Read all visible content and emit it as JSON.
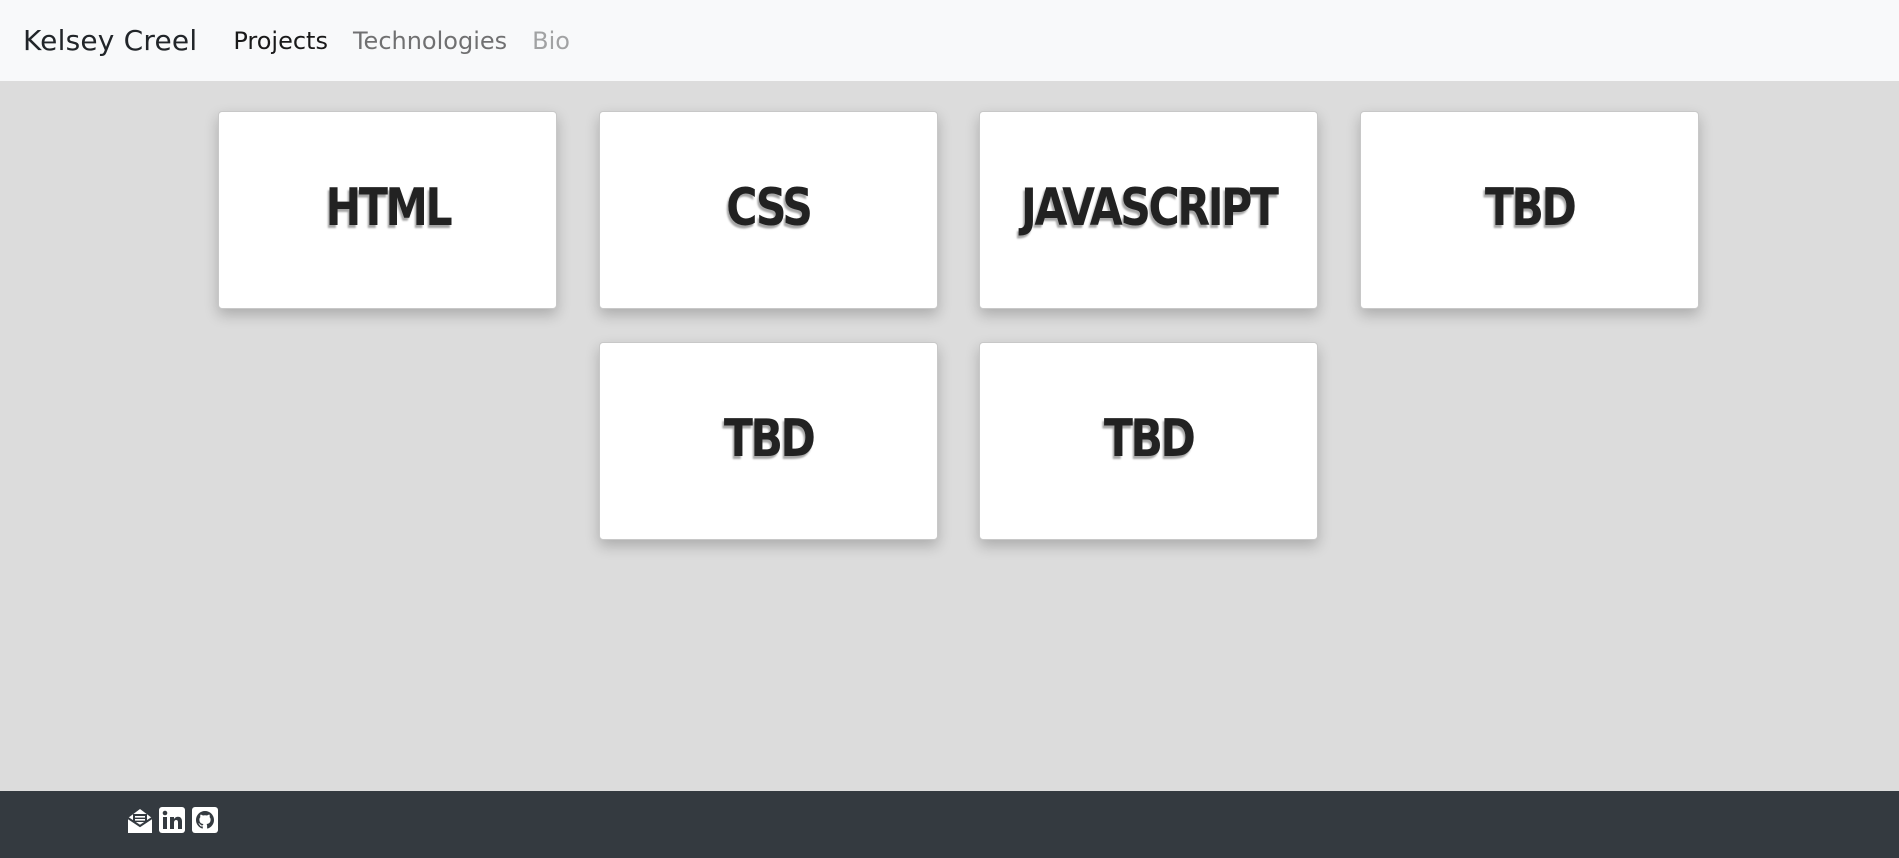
{
  "navbar": {
    "brand": "Kelsey Creel",
    "links": [
      {
        "label": "Projects",
        "state": "active"
      },
      {
        "label": "Technologies",
        "state": "default"
      },
      {
        "label": "Bio",
        "state": "disabled"
      }
    ]
  },
  "cards": [
    {
      "title": "HTML"
    },
    {
      "title": "CSS"
    },
    {
      "title": "JAVASCRIPT"
    },
    {
      "title": "TBD"
    },
    {
      "title": "TBD"
    },
    {
      "title": "TBD"
    }
  ],
  "footer": {
    "icons": [
      "email-icon",
      "linkedin-icon",
      "github-icon"
    ]
  },
  "colors": {
    "page_background": "#dcdcdc",
    "navbar_background": "#f8f9fa",
    "footer_background": "#343a40",
    "card_background": "#ffffff",
    "card_text": "#222222"
  }
}
